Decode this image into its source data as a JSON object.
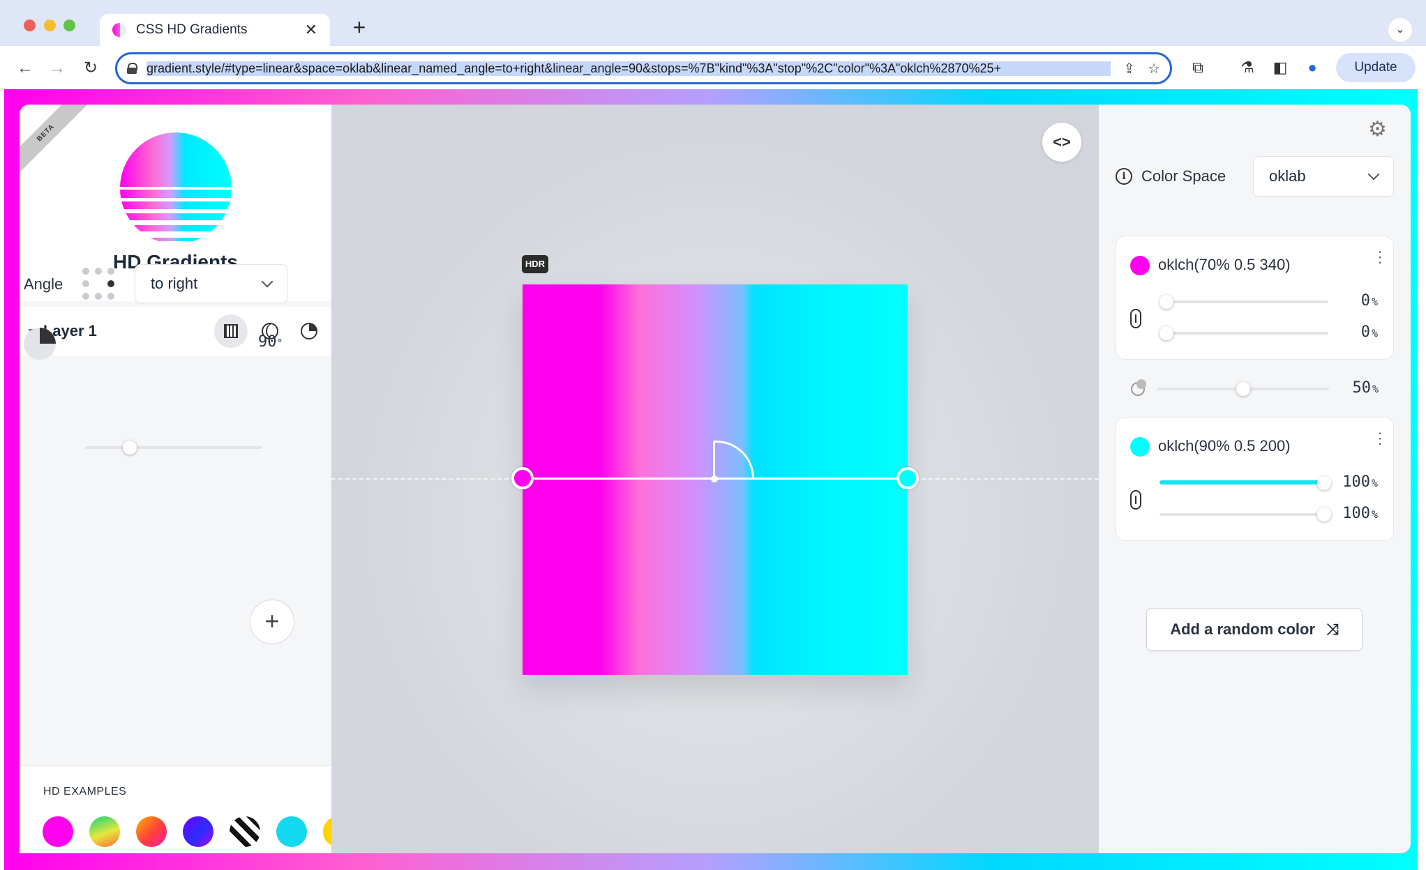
{
  "browser": {
    "tab_title": "CSS HD Gradients",
    "url": "gradient.style/#type=linear&space=oklab&linear_named_angle=to+right&linear_angle=90&stops=%7B\"kind\"%3A\"stop\"%2C\"color\"%3A\"oklch%2870%25+",
    "update_label": "Update"
  },
  "sidebar": {
    "beta_label": "BETA",
    "app_title": "HD Gradients",
    "layer": {
      "title": "Layer 1",
      "types": [
        "linear",
        "radial",
        "conic"
      ],
      "active_type": "linear"
    },
    "angle": {
      "label": "Angle",
      "named": "to right",
      "degrees": 90,
      "value_text": "90",
      "unit": "°"
    },
    "examples": {
      "label": "HD EXAMPLES",
      "swatches": [
        "magenta",
        "rainbow",
        "sunset",
        "violet",
        "stripes",
        "cyan",
        "yellow"
      ]
    }
  },
  "canvas": {
    "hdr_badge": "HDR",
    "code_toggle": "<>",
    "gradient_stops": [
      {
        "color": "#ff00ee",
        "position": 0
      },
      {
        "color": "#00ffff",
        "position": 100
      }
    ],
    "midpoint": 50
  },
  "panel": {
    "color_space_label": "Color Space",
    "color_space": "oklab",
    "stops": [
      {
        "name": "oklch(70% 0.5 340)",
        "swatch": "#ff00ee",
        "start": "0",
        "end": "0",
        "start_fraction": 0,
        "end_fraction": 0
      },
      {
        "name": "oklch(90% 0.5 200)",
        "swatch": "#00ffff",
        "start": "100",
        "end": "100",
        "start_fraction": 1,
        "end_fraction": 1
      }
    ],
    "hint_value": "50",
    "hint_fraction": 0.5,
    "percent_symbol": "%",
    "add_random_label": "Add a random color"
  },
  "colors": {
    "accent": "#2566d8",
    "slider_fill": "#17e3f0",
    "magenta": "#ff00ee",
    "cyan": "#00ffff"
  }
}
